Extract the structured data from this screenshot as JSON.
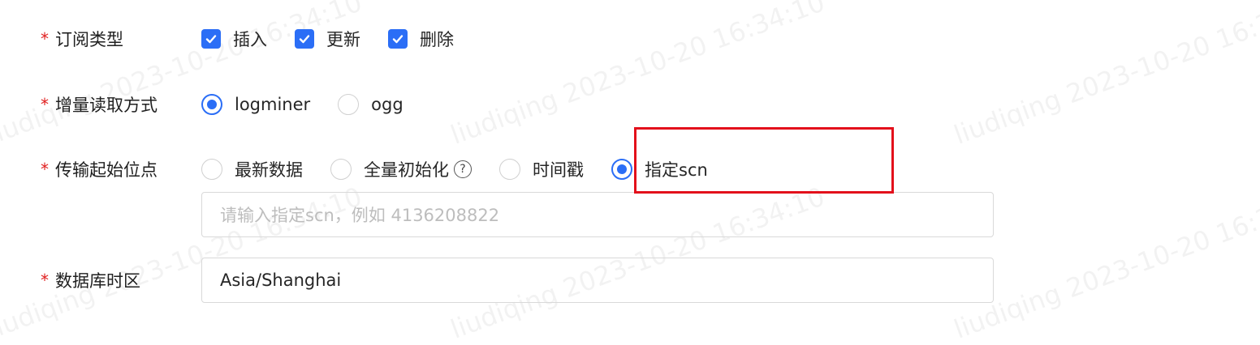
{
  "watermark": "liudiqing 2023-10-20 16:34:10",
  "required_mark": "*",
  "form": {
    "subscribe_type": {
      "label": "订阅类型",
      "options": [
        {
          "label": "插入",
          "checked": true
        },
        {
          "label": "更新",
          "checked": true
        },
        {
          "label": "删除",
          "checked": true
        }
      ]
    },
    "incremental_read": {
      "label": "增量读取方式",
      "options": [
        {
          "label": "logminer",
          "selected": true
        },
        {
          "label": "ogg",
          "selected": false
        }
      ]
    },
    "start_position": {
      "label": "传输起始位点",
      "options": [
        {
          "label": "最新数据",
          "selected": false
        },
        {
          "label": "全量初始化",
          "selected": false,
          "help": "?"
        },
        {
          "label": "时间戳",
          "selected": false
        },
        {
          "label": "指定scn",
          "selected": true
        }
      ],
      "scn_input": {
        "placeholder": "请输入指定scn，例如 4136208822",
        "value": ""
      }
    },
    "db_timezone": {
      "label": "数据库时区",
      "value": "Asia/Shanghai"
    }
  },
  "colors": {
    "accent": "#2b6ef6",
    "required": "#e02020",
    "highlight": "#e3101b"
  }
}
